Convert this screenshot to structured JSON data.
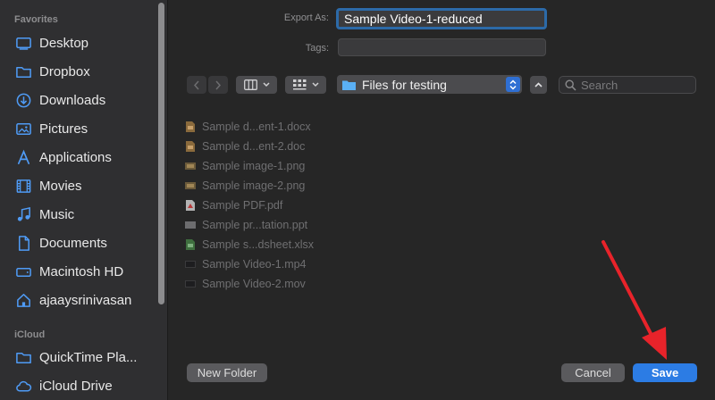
{
  "sidebar": {
    "favorites_label": "Favorites",
    "items": [
      {
        "label": "Desktop",
        "icon": "desktop-icon"
      },
      {
        "label": "Dropbox",
        "icon": "folder-icon"
      },
      {
        "label": "Downloads",
        "icon": "download-icon"
      },
      {
        "label": "Pictures",
        "icon": "pictures-icon"
      },
      {
        "label": "Applications",
        "icon": "applications-icon"
      },
      {
        "label": "Movies",
        "icon": "movies-icon"
      },
      {
        "label": "Music",
        "icon": "music-icon"
      },
      {
        "label": "Documents",
        "icon": "document-icon"
      },
      {
        "label": "Macintosh HD",
        "icon": "harddrive-icon"
      },
      {
        "label": "ajaaysrinivasan",
        "icon": "home-icon"
      }
    ],
    "icloud_label": "iCloud",
    "icloud_items": [
      {
        "label": "QuickTime Pla...",
        "icon": "folder-icon"
      },
      {
        "label": "iCloud Drive",
        "icon": "cloud-icon"
      }
    ]
  },
  "form": {
    "export_as_label": "Export As:",
    "export_as_value": "Sample Video-1-reduced",
    "tags_label": "Tags:",
    "tags_value": ""
  },
  "toolbar": {
    "folder_name": "Files for testing",
    "search_placeholder": "Search"
  },
  "files": [
    {
      "name": "Sample d...ent-1.docx",
      "type": "docx"
    },
    {
      "name": "Sample d...ent-2.doc",
      "type": "doc"
    },
    {
      "name": "Sample image-1.png",
      "type": "png"
    },
    {
      "name": "Sample image-2.png",
      "type": "png"
    },
    {
      "name": "Sample PDF.pdf",
      "type": "pdf"
    },
    {
      "name": "Sample pr...tation.ppt",
      "type": "ppt"
    },
    {
      "name": "Sample s...dsheet.xlsx",
      "type": "xlsx"
    },
    {
      "name": "Sample Video-1.mp4",
      "type": "video"
    },
    {
      "name": "Sample Video-2.mov",
      "type": "video"
    }
  ],
  "buttons": {
    "new_folder": "New Folder",
    "cancel": "Cancel",
    "save": "Save"
  },
  "colors": {
    "accent": "#2c7ce4",
    "annotation_arrow": "#e8232a"
  }
}
